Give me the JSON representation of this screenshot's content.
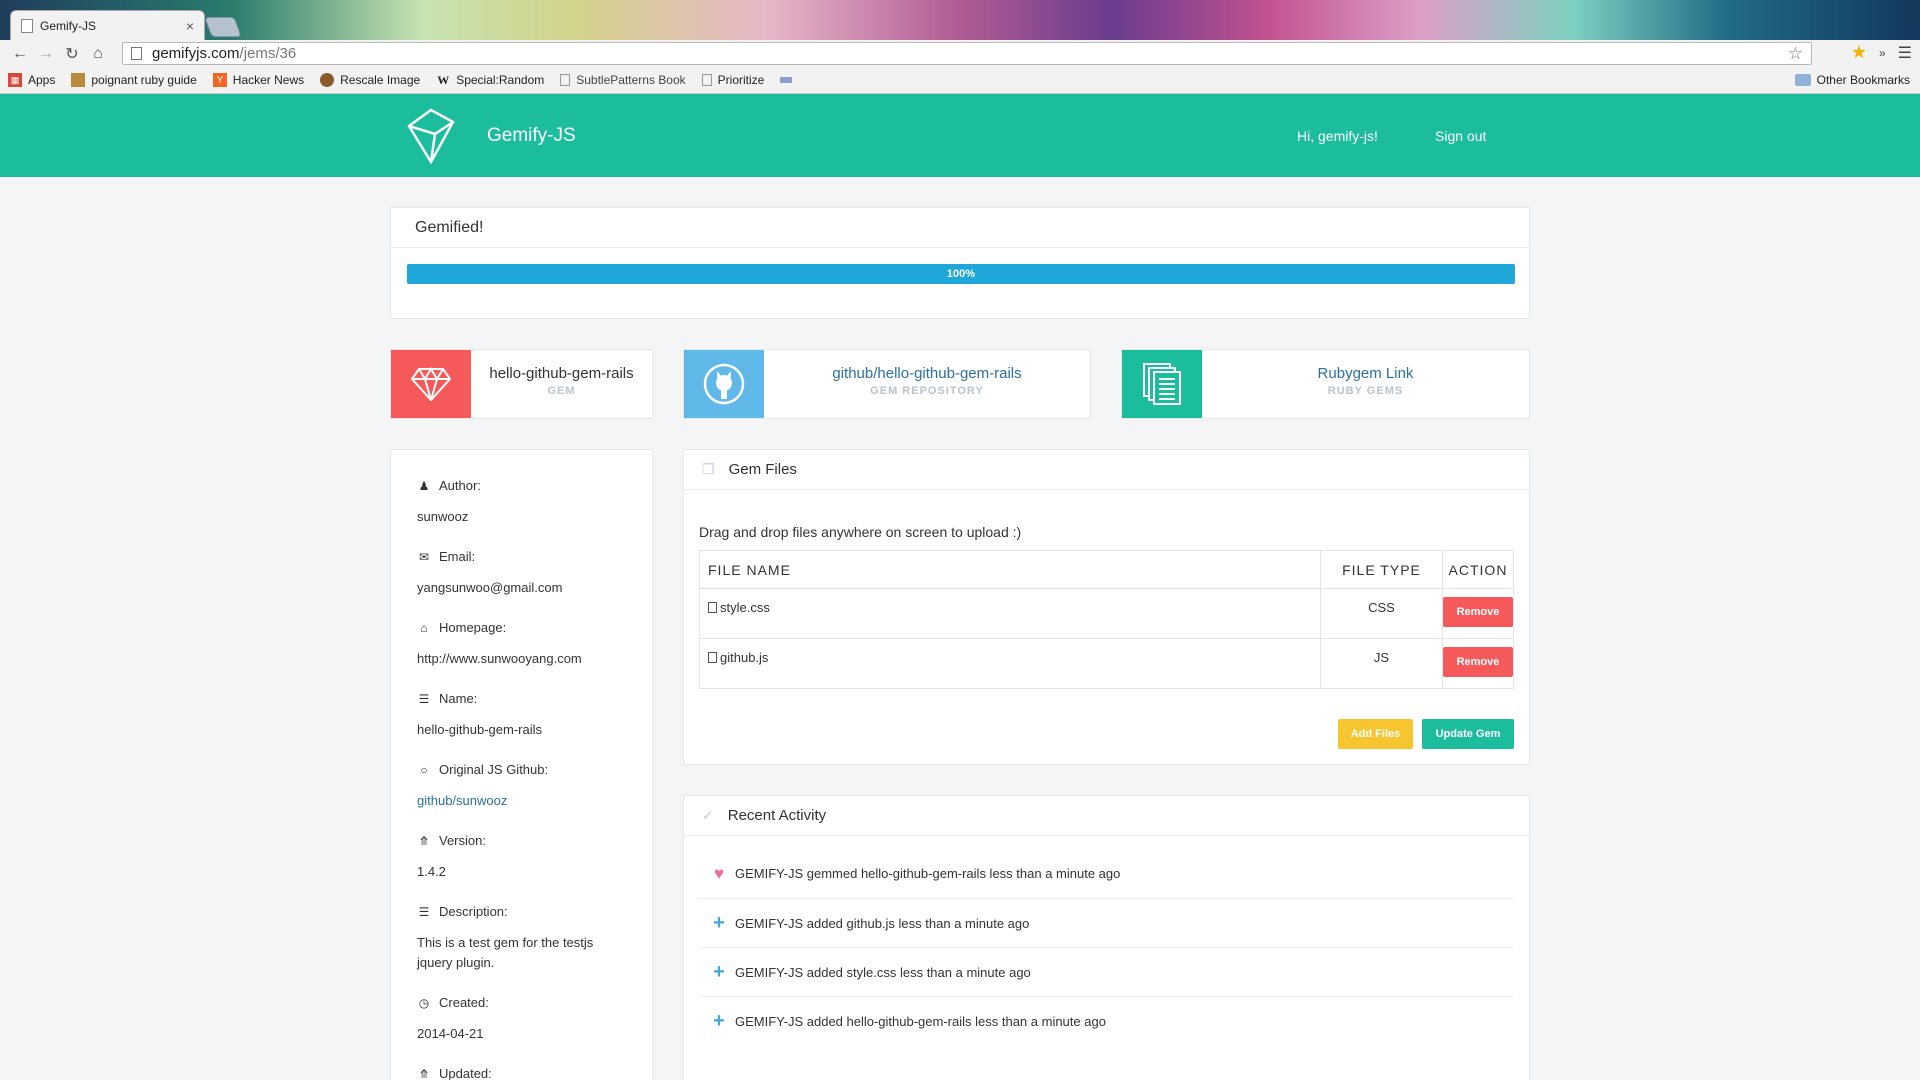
{
  "browser": {
    "tab_title": "Gemify-JS",
    "tab_close": "×",
    "url_host": "gemifyjs.com",
    "url_path": "/jems/36",
    "bookmarks": [
      {
        "label": "Apps",
        "icon": "apps-grid-icon",
        "color": "#d14b3b"
      },
      {
        "label": "poignant ruby guide",
        "icon": "book-icon",
        "color": "#b88b3a"
      },
      {
        "label": "Hacker News",
        "icon": "y-icon",
        "color": "#f26522"
      },
      {
        "label": "Rescale Image",
        "icon": "rescale-icon",
        "color": "#8a5a2b"
      },
      {
        "label": "Special:Random",
        "icon": "wikipedia-icon",
        "color": "#444444"
      },
      {
        "label": "SubtlePatterns Book",
        "icon": "page-icon",
        "color": "#cccccc"
      },
      {
        "label": "Prioritize",
        "icon": "page-icon",
        "color": "#cccccc"
      }
    ],
    "other_bookmarks": "Other Bookmarks"
  },
  "header": {
    "brand": "Gemify-JS",
    "greeting": "Hi, gemify-js!",
    "signout": "Sign out",
    "color": "#1bbd9d"
  },
  "progress": {
    "title": "Gemified!",
    "label": "100%",
    "value": 1.0,
    "color": "#1fa7d9"
  },
  "stats": [
    {
      "main": "hello-github-gem-rails",
      "sub": "GEM",
      "icon": "diamond-icon",
      "color": "#f5595a"
    },
    {
      "main": "github/hello-github-gem-rails",
      "sub": "GEM REPOSITORY",
      "icon": "github-icon",
      "color": "#60b8e8"
    },
    {
      "main": "Rubygem Link",
      "sub": "RUBY GEMS",
      "icon": "documents-icon",
      "color": "#1bbd9d"
    }
  ],
  "info": {
    "author_label": "Author:",
    "author": "sunwooz",
    "email_label": "Email:",
    "email": "yangsunwoo@gmail.com",
    "homepage_label": "Homepage:",
    "homepage": "http://www.sunwooyang.com",
    "name_label": "Name:",
    "name": "hello-github-gem-rails",
    "github_label": "Original JS Github:",
    "github": "github/sunwooz",
    "version_label": "Version:",
    "version": "1.4.2",
    "description_label": "Description:",
    "description": "This is a test gem for the testjs jquery plugin.",
    "created_label": "Created:",
    "created": "2014-04-21",
    "updated_label": "Updated:"
  },
  "files": {
    "title": "Gem Files",
    "note": "Drag and drop files anywhere on screen to upload :)",
    "headers": {
      "name": "FILE NAME",
      "type": "FILE TYPE",
      "action": "ACTION"
    },
    "rows": [
      {
        "name": "style.css",
        "type": "CSS",
        "action": "Remove"
      },
      {
        "name": "github.js",
        "type": "JS",
        "action": "Remove"
      }
    ],
    "add_label": "Add Files",
    "update_label": "Update Gem"
  },
  "activity": {
    "title": "Recent Activity",
    "items": [
      {
        "icon": "heart-icon",
        "text": "GEMIFY-JS gemmed hello-github-gem-rails less than a minute ago"
      },
      {
        "icon": "plus-icon",
        "text": "GEMIFY-JS added github.js less than a minute ago"
      },
      {
        "icon": "plus-icon",
        "text": "GEMIFY-JS added style.css less than a minute ago"
      },
      {
        "icon": "plus-icon",
        "text": "GEMIFY-JS added hello-github-gem-rails less than a minute ago"
      }
    ]
  }
}
